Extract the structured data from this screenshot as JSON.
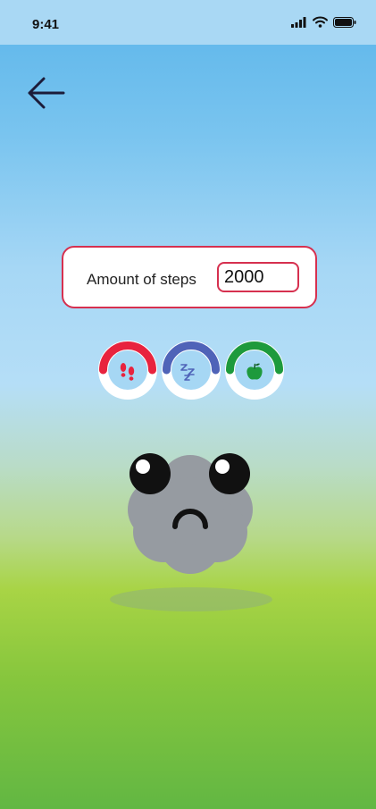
{
  "status_bar": {
    "time": "9:41",
    "icons": [
      "signal-icon",
      "wifi-icon",
      "battery-icon"
    ]
  },
  "nav": {
    "back_icon": "arrow-left-icon"
  },
  "steps": {
    "label": "Amount of steps",
    "value": "2000"
  },
  "rings": [
    {
      "name": "steps",
      "icon": "footprints-icon",
      "color": "#e8233e",
      "progress": 0.5
    },
    {
      "name": "sleep",
      "icon": "zzz-icon",
      "color": "#4f63b8",
      "progress": 0.5
    },
    {
      "name": "food",
      "icon": "apple-icon",
      "color": "#1e9a3c",
      "progress": 0.5
    }
  ],
  "mascot": {
    "mood": "sad",
    "body_color": "#969ba1"
  }
}
